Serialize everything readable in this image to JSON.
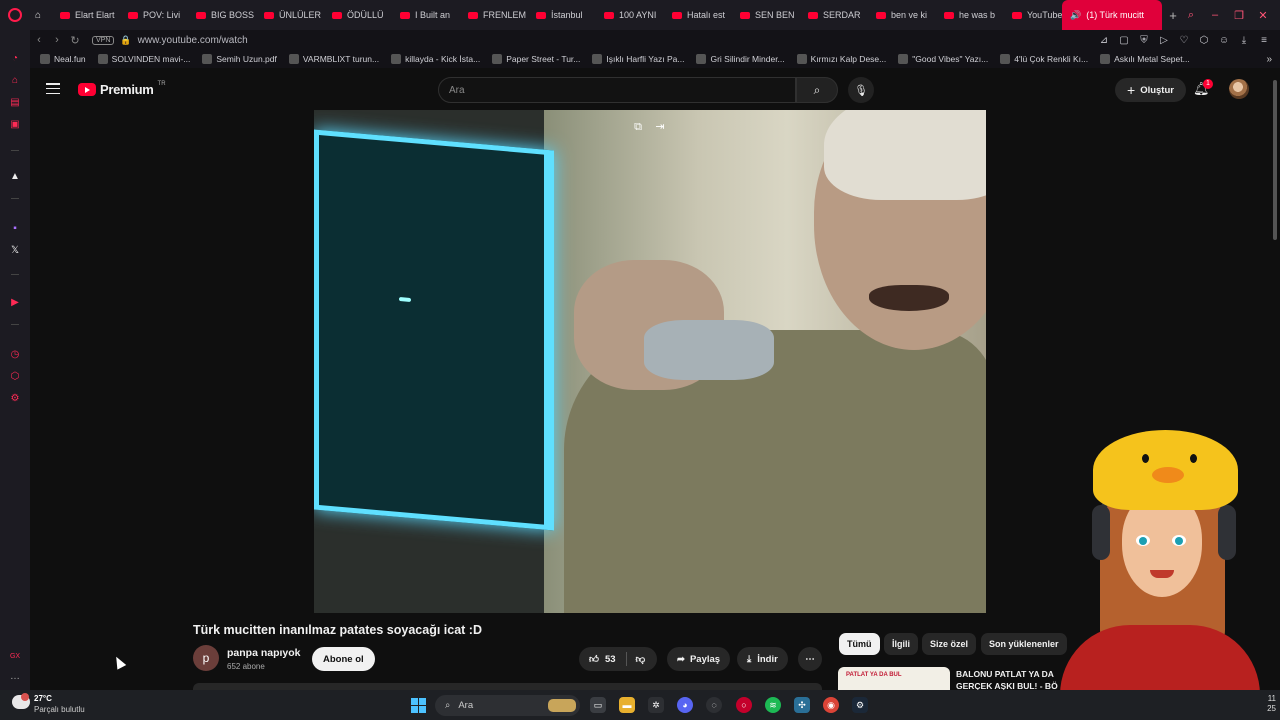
{
  "browser": {
    "tabs": [
      {
        "label": "Elart Elart"
      },
      {
        "label": "POV: Livi"
      },
      {
        "label": "BIG BOSS"
      },
      {
        "label": "ÜNLÜLER"
      },
      {
        "label": "ÖDÜLLÜ"
      },
      {
        "label": "I Built an"
      },
      {
        "label": "FRENLEM"
      },
      {
        "label": "İstanbul"
      },
      {
        "label": "100 AYNI"
      },
      {
        "label": "Hatalı est"
      },
      {
        "label": "SEN BEN"
      },
      {
        "label": "SERDAR"
      },
      {
        "label": "ben ve ki"
      },
      {
        "label": "he was b"
      },
      {
        "label": "YouTube"
      }
    ],
    "active_tab": "(1) Türk mucitt",
    "vpn_label": "VPN",
    "url": "www.youtube.com/watch",
    "bookmarks": [
      "Neal.fun",
      "SOLVINDEN mavi-...",
      "Semih Uzun.pdf",
      "VARMBLIXT turun...",
      "killayda - Kick İsta...",
      "Paper Street - Tur...",
      "Işıklı Harfli Yazı Pa...",
      "Gri Silindir Minder...",
      "Kırmızı Kalp Dese...",
      "\"Good Vibes\" Yazı...",
      "4'lü Çok Renkli Kı...",
      "Askılı Metal Sepet..."
    ]
  },
  "yt": {
    "logo_text": "Premium",
    "region": "TR",
    "search_placeholder": "Ara",
    "create_label": "Oluştur",
    "notif_count": "1"
  },
  "video": {
    "title": "Türk mucitten inanılmaz patates soyacağı icat :D",
    "channel_initial": "p",
    "channel_name": "panpa napıyok",
    "subscribers": "652 abone",
    "subscribe_label": "Abone ol",
    "likes": "53",
    "share_label": "Paylaş",
    "download_label": "İndir"
  },
  "chips": [
    "Tümü",
    "İlgili",
    "Size özel",
    "Son yüklenenler"
  ],
  "recommendation": {
    "thumb_text": "PATLAT YA DA BUL",
    "title": "BALONU PATLAT YA DA GERÇEK AŞKI BUL! - BÖ"
  },
  "taskbar": {
    "temperature": "27°C",
    "weather": "Parçalı bulutlu",
    "search_label": "Ara",
    "time_line1": "11",
    "time_line2": "25"
  },
  "colors": {
    "accent": "#ff0033",
    "opera_red": "#e0003a",
    "background": "#0f0f0f"
  }
}
